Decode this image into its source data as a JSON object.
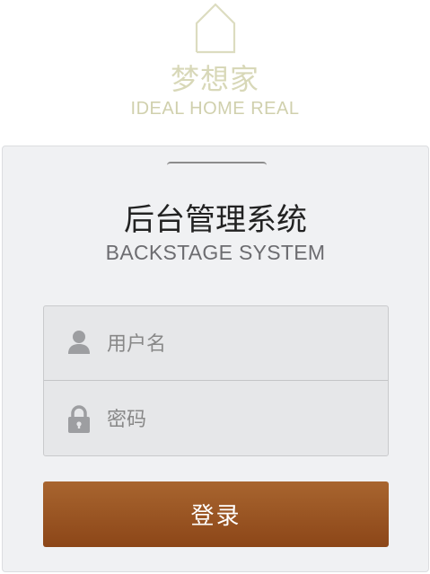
{
  "brand": {
    "name_cn": "梦想家",
    "name_en": "IDEAL HOME REAL"
  },
  "login": {
    "title": "后台管理系统",
    "subtitle": "BACKSTAGE SYSTEM",
    "username_placeholder": "用户名",
    "password_placeholder": "密码",
    "submit_label": "登录"
  },
  "icons": {
    "logo": "house-outline-icon",
    "username": "user-icon",
    "password": "lock-icon"
  },
  "colors": {
    "brand_text": "#d8d8b8",
    "button_top": "#a8652f",
    "button_bottom": "#8c4618",
    "card_bg": "#f0f1f3"
  }
}
